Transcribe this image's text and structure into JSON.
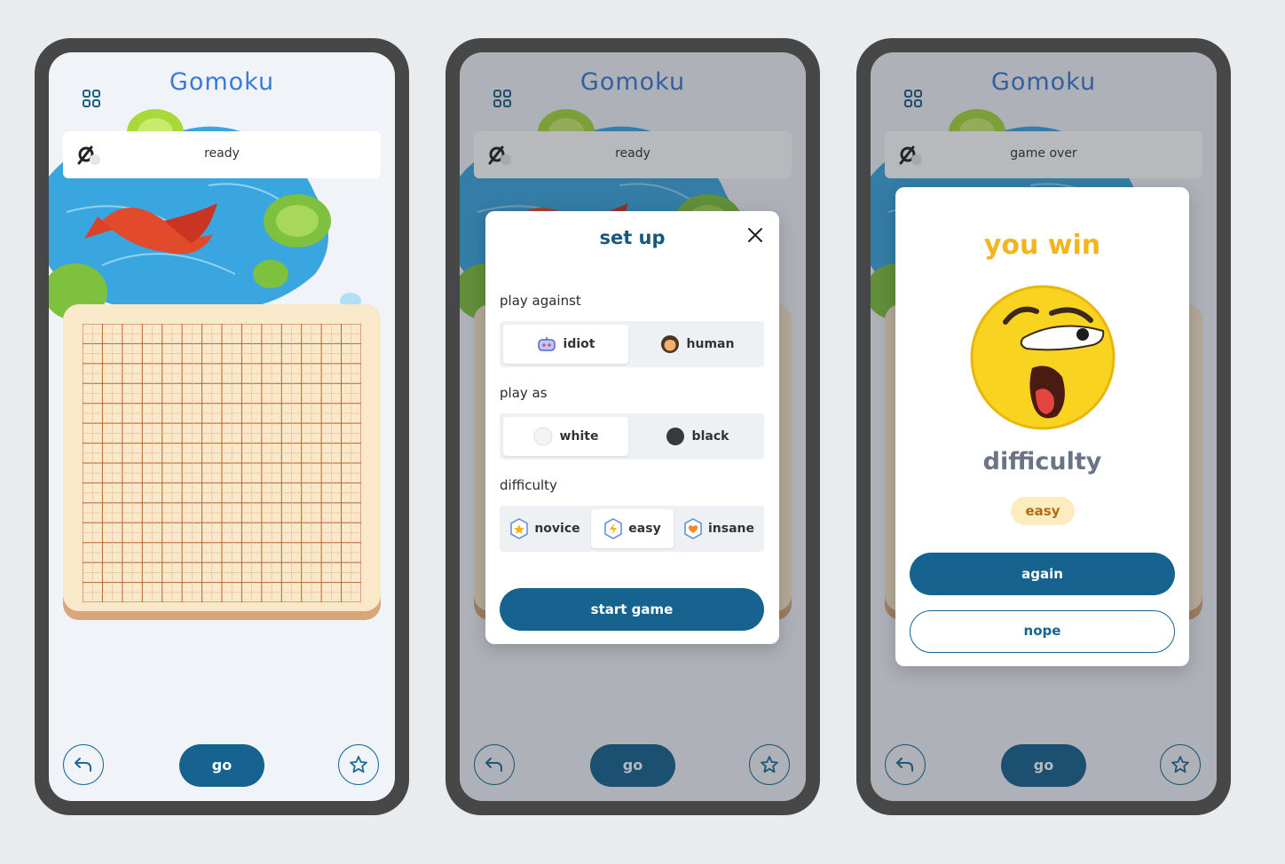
{
  "app": {
    "logo": "Gomoku"
  },
  "screens": [
    {
      "status": "ready",
      "go_label": "go"
    },
    {
      "status": "ready",
      "go_label": "go"
    },
    {
      "status": "game over",
      "go_label": "go"
    }
  ],
  "setup_modal": {
    "title": "set up",
    "play_against": {
      "label": "play against",
      "options": [
        {
          "label": "idiot",
          "icon": "robot-icon",
          "selected": true
        },
        {
          "label": "human",
          "icon": "human-avatar-icon",
          "selected": false
        }
      ]
    },
    "play_as": {
      "label": "play as",
      "options": [
        {
          "label": "white",
          "icon": "white-stone-icon",
          "selected": true
        },
        {
          "label": "black",
          "icon": "black-stone-icon",
          "selected": false
        }
      ]
    },
    "difficulty": {
      "label": "difficulty",
      "options": [
        {
          "label": "novice",
          "icon": "star-hex-icon",
          "selected": false
        },
        {
          "label": "easy",
          "icon": "bolt-hex-icon",
          "selected": true
        },
        {
          "label": "insane",
          "icon": "heart-hex-icon",
          "selected": false
        }
      ]
    },
    "start_label": "start game"
  },
  "result_modal": {
    "title": "you win",
    "face_icon": "shocked-face-icon",
    "difficulty_label": "difficulty",
    "difficulty_value": "easy",
    "again_label": "again",
    "nope_label": "nope"
  },
  "colors": {
    "primary": "#16638f",
    "board": "#fae8cb",
    "grid_line": "#b5652d",
    "phone_frame": "#474747",
    "win_title": "#f2b51f"
  }
}
